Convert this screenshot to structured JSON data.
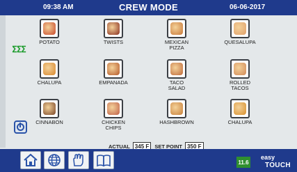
{
  "header": {
    "time": "09:38 AM",
    "title": "CREW MODE",
    "date": "06-06-2017"
  },
  "items": [
    {
      "label": "POTATO",
      "color": "#c8482a"
    },
    {
      "label": "TWISTS",
      "color": "#8a3020"
    },
    {
      "label": "MEXICAN\nPIZZA",
      "color": "#c87838"
    },
    {
      "label": "QUESALUPA",
      "color": "#e0a06a"
    },
    {
      "label": "CHALUPA",
      "color": "#d8882e"
    },
    {
      "label": "EMPANADA",
      "color": "#b65a2a"
    },
    {
      "label": "TACO\nSALAD",
      "color": "#c06a3a"
    },
    {
      "label": "ROLLED\nTACOS",
      "color": "#d28a58"
    },
    {
      "label": "CINNABON",
      "color": "#7a4628"
    },
    {
      "label": "CHICKEN\nCHIPS",
      "color": "#c06048"
    },
    {
      "label": "HASHBROWN",
      "color": "#c8803a"
    },
    {
      "label": "CHALUPA",
      "color": "#d8902e"
    }
  ],
  "temperature": {
    "actual_label": "ACTUAL",
    "actual_value": "345 F",
    "setpoint_label": "SET POINT",
    "setpoint_value": "350 F"
  },
  "footer": {
    "version": "11.6",
    "brand_top": "easy",
    "brand_bottom": "TOUCH"
  },
  "indicators": {
    "heat_symbol": "ⵉⵉⵉ"
  },
  "colors": {
    "bar": "#1f3a8c",
    "background": "#e4e8ea",
    "version_badge": "#2f8f2f"
  }
}
